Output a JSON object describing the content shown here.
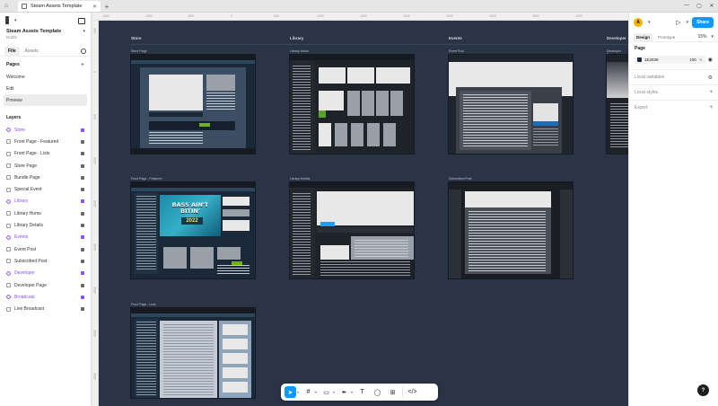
{
  "tabs": [
    {
      "label": "Steam Assets Template"
    }
  ],
  "project": {
    "name": "Steam Assets Template",
    "subtitle": "Drafts"
  },
  "left_tabs": {
    "file": "File",
    "assets": "Assets"
  },
  "pages": {
    "heading": "Pages",
    "items": [
      "Welcome",
      "Edit",
      "Preview"
    ]
  },
  "layers": {
    "heading": "Layers",
    "items": [
      {
        "label": "Store",
        "component": true
      },
      {
        "label": "Front Page - Featured",
        "component": false
      },
      {
        "label": "Front Page - Lists",
        "component": false
      },
      {
        "label": "Store Page",
        "component": false
      },
      {
        "label": "Bundle Page",
        "component": false
      },
      {
        "label": "Special Event",
        "component": false
      },
      {
        "label": "Library",
        "component": true
      },
      {
        "label": "Library Home",
        "component": false
      },
      {
        "label": "Library Details",
        "component": false
      },
      {
        "label": "Events",
        "component": true
      },
      {
        "label": "Event Post",
        "component": false
      },
      {
        "label": "Subscribed Post",
        "component": false
      },
      {
        "label": "Developer",
        "component": true
      },
      {
        "label": "Developer Page",
        "component": false
      },
      {
        "label": "Broadcast",
        "component": true
      },
      {
        "label": "Live Broadcast",
        "component": false
      }
    ]
  },
  "ruler": {
    "top": [
      "-1500",
      "-1000",
      "-500",
      "0",
      "500",
      "1000",
      "1500",
      "2000",
      "2500",
      "3000",
      "3500",
      "4000"
    ],
    "left": [
      "-500",
      "0",
      "500",
      "1000",
      "1500",
      "2000",
      "2500",
      "3000",
      "3500"
    ]
  },
  "canvas": {
    "sections": [
      "Store",
      "Library",
      "Events",
      "Developer"
    ],
    "frames": [
      "Store Page",
      "Library Home",
      "Event Post",
      "Developer Page",
      "Front Page - Featured",
      "Library Details",
      "Subscribed Post",
      "Front Page - Lists"
    ],
    "banner_text": "BASS AIN'T BITIN'",
    "banner_year": "2022"
  },
  "right_panel": {
    "avatar": "A",
    "share": "Share",
    "tabs": {
      "design": "Design",
      "prototype": "Prototype"
    },
    "zoom": "15%",
    "page_heading": "Page",
    "page_color": "1E2838",
    "page_opacity": "100",
    "page_opacity_unit": "%",
    "rows": [
      "Local variables",
      "Local styles",
      "Export"
    ]
  },
  "colors": {
    "accent": "#0d99ff",
    "component": "#8c4ff5",
    "canvas": "#2a3444"
  }
}
